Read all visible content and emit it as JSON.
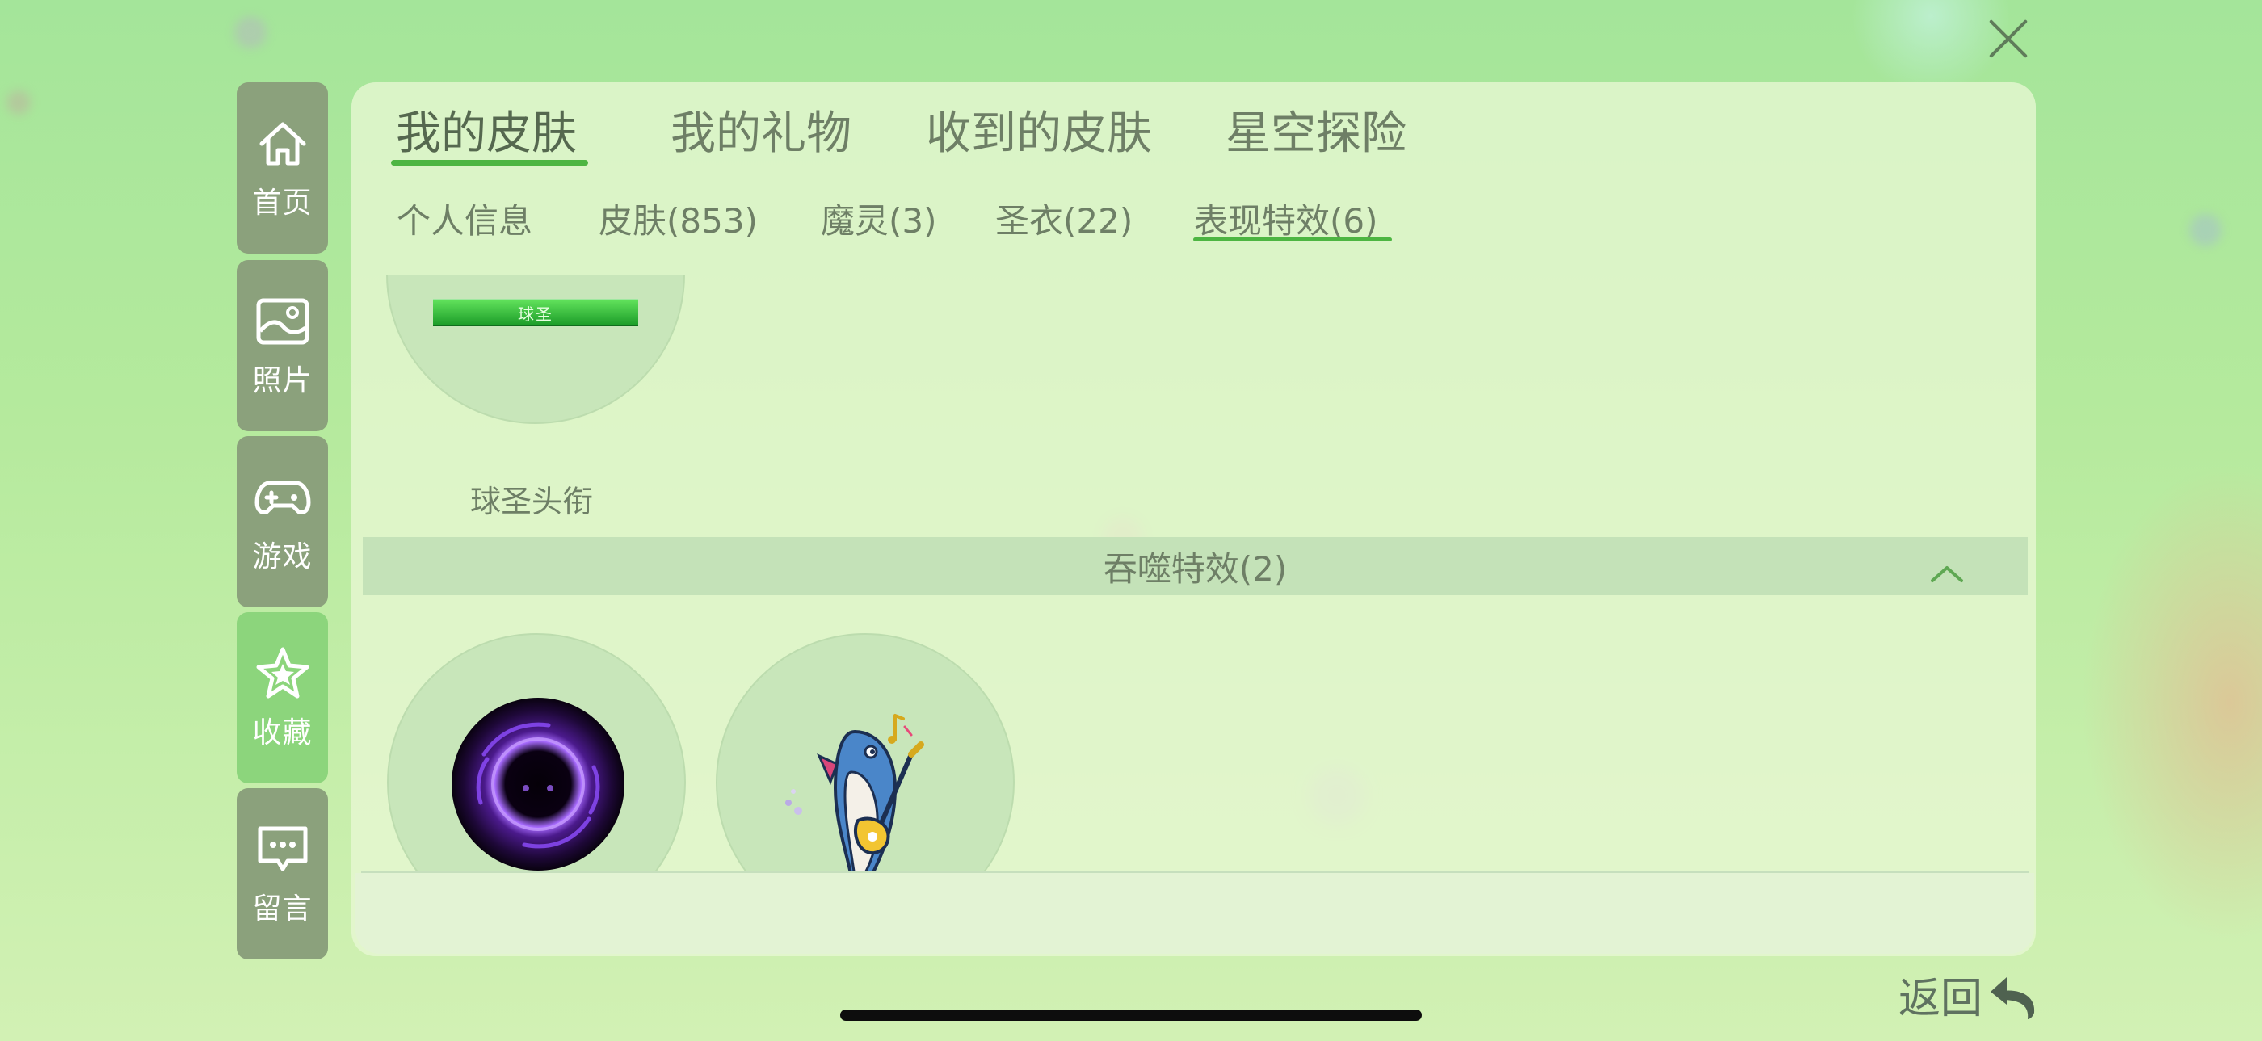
{
  "sidebar": {
    "items": [
      {
        "label": "首页",
        "icon": "home-icon"
      },
      {
        "label": "照片",
        "icon": "photo-icon"
      },
      {
        "label": "游戏",
        "icon": "gamepad-icon"
      },
      {
        "label": "收藏",
        "icon": "star-icon",
        "active": true
      },
      {
        "label": "留言",
        "icon": "message-icon"
      }
    ]
  },
  "tabs_main": [
    "我的皮肤",
    "我的礼物",
    "收到的皮肤",
    "星空探险"
  ],
  "tabs_main_active": "我的皮肤",
  "tabs_sub": [
    "个人信息",
    "皮肤(853)",
    "魔灵(3)",
    "圣衣(22)",
    "表现特效(6)"
  ],
  "tabs_sub_active": "表现特效(6)",
  "title_item": {
    "label": "球圣头衔",
    "badge_text": "球圣"
  },
  "section": {
    "title": "吞噬特效(2)",
    "expanded": true
  },
  "effects": [
    {
      "icon": "purple-vortex-icon"
    },
    {
      "icon": "guitar-fish-icon"
    }
  ],
  "back_label": "返回",
  "colors": {
    "accent_green": "#4db542",
    "sidebar_bg": "#8ba17c",
    "sidebar_active_bg": "#8cd57c",
    "text": "#6e7f66"
  }
}
